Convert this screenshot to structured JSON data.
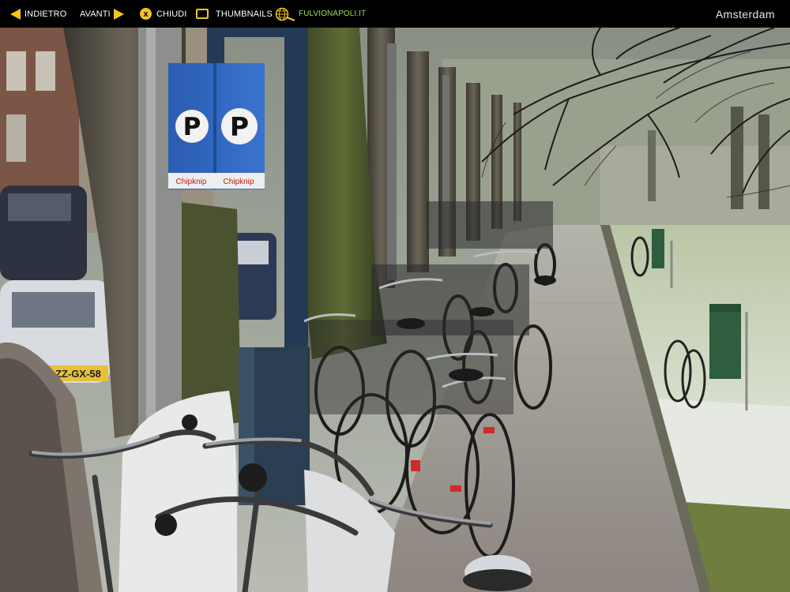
{
  "toolbar": {
    "prev_label": "INDIETRO",
    "next_label": "AVANTI",
    "close_label": "CHIUDI",
    "close_glyph": "x",
    "thumbnails_label": "THUMBNAILS",
    "site_label": "FULVIONAPOLI.IT",
    "accent_color": "#f3c51e",
    "site_color": "#9be04a"
  },
  "title": "Amsterdam",
  "photo": {
    "sign_letter_left": "P",
    "sign_letter_right": "P",
    "sign_brand_left": "Chipknip",
    "sign_brand_right": "Chipknip",
    "license_plate": "ZZ-GX-58"
  },
  "icons": {
    "prev": "arrow-left-icon",
    "next": "arrow-right-icon",
    "close": "close-icon",
    "thumbnails": "thumbnails-icon",
    "site": "globe-icon"
  }
}
